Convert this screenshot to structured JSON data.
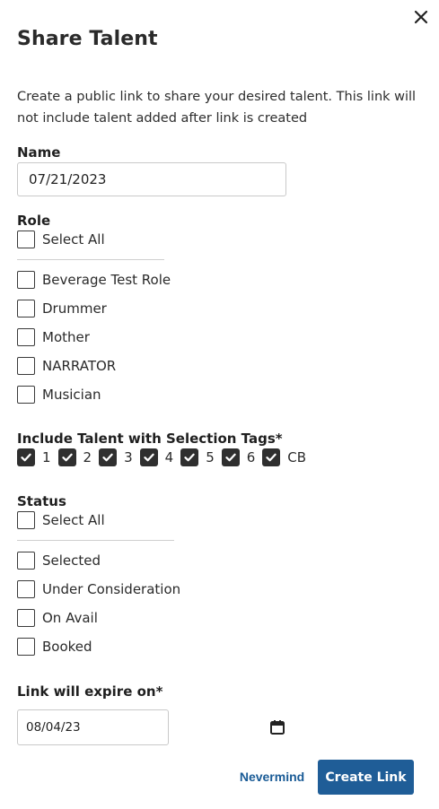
{
  "dialog": {
    "title": "Share Talent",
    "description": "Create a public link to share your desired talent. This link will not include talent added after link is created"
  },
  "name": {
    "label": "Name",
    "value": "07/21/2023"
  },
  "role": {
    "label": "Role",
    "select_all": "Select All",
    "items": [
      "Beverage Test Role",
      "Drummer",
      "Mother",
      "NARRATOR",
      "Musician"
    ]
  },
  "tags": {
    "label": "Include Talent with Selection Tags*",
    "items": [
      "1",
      "2",
      "3",
      "4",
      "5",
      "6",
      "CB"
    ]
  },
  "status": {
    "label": "Status",
    "select_all": "Select All",
    "items": [
      "Selected",
      "Under Consideration",
      "On Avail",
      "Booked"
    ]
  },
  "expiry": {
    "label": "Link will expire on*",
    "value": "08/04/23"
  },
  "actions": {
    "cancel": "Nevermind",
    "create": "Create Link"
  }
}
